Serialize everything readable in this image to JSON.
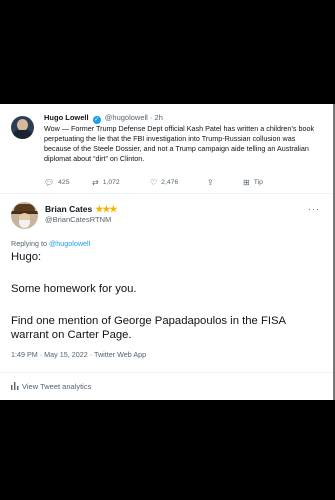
{
  "quoted_tweet": {
    "name": "Hugo Lowell",
    "handle": "@hugolowell",
    "time": "2h",
    "text": "Wow — Former Trump Defense Dept official Kash Patel has written a children’s book perpetuating the lie that the FBI investigation into Trump-Russian collusion was because of the Steele Dossier, and not a Trump campaign aide telling an Australian diplomat about “dirt” on Clinton.",
    "actions": {
      "replies": "425",
      "retweets": "1,072",
      "likes": "2,476",
      "tip": "Tip"
    }
  },
  "tweet": {
    "name": "Brian Cates",
    "stars": "★★★",
    "handle": "@BrianCatesRTNM",
    "more": "···",
    "replying_prefix": "Replying to",
    "replying_to": "@hugolowell",
    "paragraphs": [
      "Hugo:",
      "Some homework for you.",
      "Find one mention of George Papadapoulos in the FISA warrant on Carter Page."
    ],
    "meta": "1:49 PM · May 15, 2022 · Twitter Web App",
    "analytics": "View Tweet analytics"
  },
  "icons": {
    "reply": "reply-icon",
    "retweet": "retweet-icon",
    "like": "heart-icon",
    "share": "share-icon",
    "tip": "tip-icon",
    "analytics": "bar-chart-icon",
    "verified": "verified-badge-icon",
    "more": "more-icon"
  },
  "colors": {
    "link": "#1d9bf0",
    "muted": "#536471",
    "text": "#0f1419",
    "stars": "#f4b400"
  }
}
